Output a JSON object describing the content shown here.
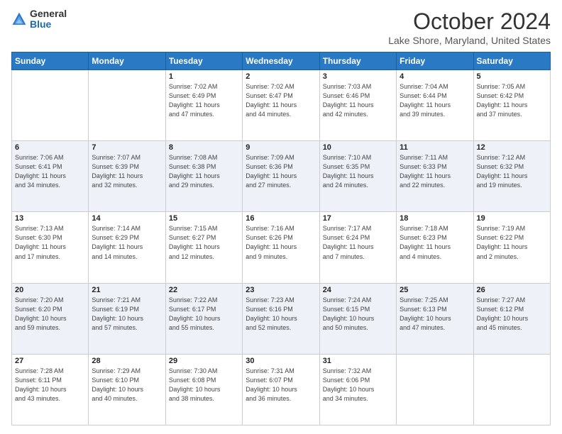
{
  "header": {
    "logo": {
      "general": "General",
      "blue": "Blue"
    },
    "title": "October 2024",
    "location": "Lake Shore, Maryland, United States"
  },
  "weekdays": [
    "Sunday",
    "Monday",
    "Tuesday",
    "Wednesday",
    "Thursday",
    "Friday",
    "Saturday"
  ],
  "weeks": [
    [
      {
        "day": "",
        "info": ""
      },
      {
        "day": "",
        "info": ""
      },
      {
        "day": "1",
        "info": "Sunrise: 7:02 AM\nSunset: 6:49 PM\nDaylight: 11 hours\nand 47 minutes."
      },
      {
        "day": "2",
        "info": "Sunrise: 7:02 AM\nSunset: 6:47 PM\nDaylight: 11 hours\nand 44 minutes."
      },
      {
        "day": "3",
        "info": "Sunrise: 7:03 AM\nSunset: 6:46 PM\nDaylight: 11 hours\nand 42 minutes."
      },
      {
        "day": "4",
        "info": "Sunrise: 7:04 AM\nSunset: 6:44 PM\nDaylight: 11 hours\nand 39 minutes."
      },
      {
        "day": "5",
        "info": "Sunrise: 7:05 AM\nSunset: 6:42 PM\nDaylight: 11 hours\nand 37 minutes."
      }
    ],
    [
      {
        "day": "6",
        "info": "Sunrise: 7:06 AM\nSunset: 6:41 PM\nDaylight: 11 hours\nand 34 minutes."
      },
      {
        "day": "7",
        "info": "Sunrise: 7:07 AM\nSunset: 6:39 PM\nDaylight: 11 hours\nand 32 minutes."
      },
      {
        "day": "8",
        "info": "Sunrise: 7:08 AM\nSunset: 6:38 PM\nDaylight: 11 hours\nand 29 minutes."
      },
      {
        "day": "9",
        "info": "Sunrise: 7:09 AM\nSunset: 6:36 PM\nDaylight: 11 hours\nand 27 minutes."
      },
      {
        "day": "10",
        "info": "Sunrise: 7:10 AM\nSunset: 6:35 PM\nDaylight: 11 hours\nand 24 minutes."
      },
      {
        "day": "11",
        "info": "Sunrise: 7:11 AM\nSunset: 6:33 PM\nDaylight: 11 hours\nand 22 minutes."
      },
      {
        "day": "12",
        "info": "Sunrise: 7:12 AM\nSunset: 6:32 PM\nDaylight: 11 hours\nand 19 minutes."
      }
    ],
    [
      {
        "day": "13",
        "info": "Sunrise: 7:13 AM\nSunset: 6:30 PM\nDaylight: 11 hours\nand 17 minutes."
      },
      {
        "day": "14",
        "info": "Sunrise: 7:14 AM\nSunset: 6:29 PM\nDaylight: 11 hours\nand 14 minutes."
      },
      {
        "day": "15",
        "info": "Sunrise: 7:15 AM\nSunset: 6:27 PM\nDaylight: 11 hours\nand 12 minutes."
      },
      {
        "day": "16",
        "info": "Sunrise: 7:16 AM\nSunset: 6:26 PM\nDaylight: 11 hours\nand 9 minutes."
      },
      {
        "day": "17",
        "info": "Sunrise: 7:17 AM\nSunset: 6:24 PM\nDaylight: 11 hours\nand 7 minutes."
      },
      {
        "day": "18",
        "info": "Sunrise: 7:18 AM\nSunset: 6:23 PM\nDaylight: 11 hours\nand 4 minutes."
      },
      {
        "day": "19",
        "info": "Sunrise: 7:19 AM\nSunset: 6:22 PM\nDaylight: 11 hours\nand 2 minutes."
      }
    ],
    [
      {
        "day": "20",
        "info": "Sunrise: 7:20 AM\nSunset: 6:20 PM\nDaylight: 10 hours\nand 59 minutes."
      },
      {
        "day": "21",
        "info": "Sunrise: 7:21 AM\nSunset: 6:19 PM\nDaylight: 10 hours\nand 57 minutes."
      },
      {
        "day": "22",
        "info": "Sunrise: 7:22 AM\nSunset: 6:17 PM\nDaylight: 10 hours\nand 55 minutes."
      },
      {
        "day": "23",
        "info": "Sunrise: 7:23 AM\nSunset: 6:16 PM\nDaylight: 10 hours\nand 52 minutes."
      },
      {
        "day": "24",
        "info": "Sunrise: 7:24 AM\nSunset: 6:15 PM\nDaylight: 10 hours\nand 50 minutes."
      },
      {
        "day": "25",
        "info": "Sunrise: 7:25 AM\nSunset: 6:13 PM\nDaylight: 10 hours\nand 47 minutes."
      },
      {
        "day": "26",
        "info": "Sunrise: 7:27 AM\nSunset: 6:12 PM\nDaylight: 10 hours\nand 45 minutes."
      }
    ],
    [
      {
        "day": "27",
        "info": "Sunrise: 7:28 AM\nSunset: 6:11 PM\nDaylight: 10 hours\nand 43 minutes."
      },
      {
        "day": "28",
        "info": "Sunrise: 7:29 AM\nSunset: 6:10 PM\nDaylight: 10 hours\nand 40 minutes."
      },
      {
        "day": "29",
        "info": "Sunrise: 7:30 AM\nSunset: 6:08 PM\nDaylight: 10 hours\nand 38 minutes."
      },
      {
        "day": "30",
        "info": "Sunrise: 7:31 AM\nSunset: 6:07 PM\nDaylight: 10 hours\nand 36 minutes."
      },
      {
        "day": "31",
        "info": "Sunrise: 7:32 AM\nSunset: 6:06 PM\nDaylight: 10 hours\nand 34 minutes."
      },
      {
        "day": "",
        "info": ""
      },
      {
        "day": "",
        "info": ""
      }
    ]
  ]
}
